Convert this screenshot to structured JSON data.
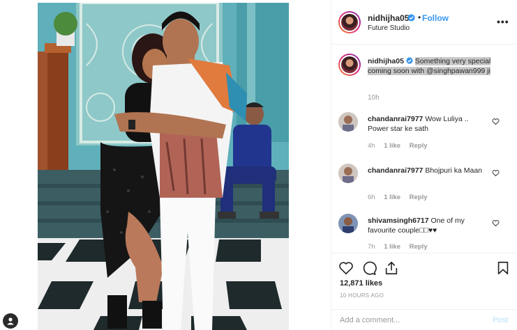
{
  "header": {
    "username": "nidhijha05",
    "separator": "•",
    "follow_label": "Follow",
    "location": "Future Studio",
    "more_label": "•••"
  },
  "caption": {
    "username": "nidhijha05",
    "text": "Something very special coming soon with @singhpawan999 ji",
    "time": "10h"
  },
  "comments": [
    {
      "username": "chandanrai7977",
      "text": "Wow Luliya .. Power star ke sath",
      "time": "4h",
      "likes": "1 like",
      "reply": "Reply"
    },
    {
      "username": "chandanrai7977",
      "text": "Bhojpuri ka Maan",
      "time": "6h",
      "likes": "1 like",
      "reply": "Reply"
    },
    {
      "username": "shivamsingh6717",
      "text": "One of my favourite couple□□♥♥",
      "time": "7h",
      "likes": "1 like",
      "reply": "Reply"
    }
  ],
  "actions": {
    "like_icon": "heart-icon",
    "comment_icon": "comment-icon",
    "share_icon": "share-icon",
    "save_icon": "bookmark-icon"
  },
  "likes_count": "12,871 likes",
  "time_ago": "10 HOURS AGO",
  "add_comment": {
    "placeholder": "Add a comment...",
    "post_label": "Post"
  },
  "colors": {
    "link_blue": "#3897f0",
    "post_disabled": "#b2dffc",
    "verified_blue": "#3897f0",
    "muted_text": "#999999"
  }
}
